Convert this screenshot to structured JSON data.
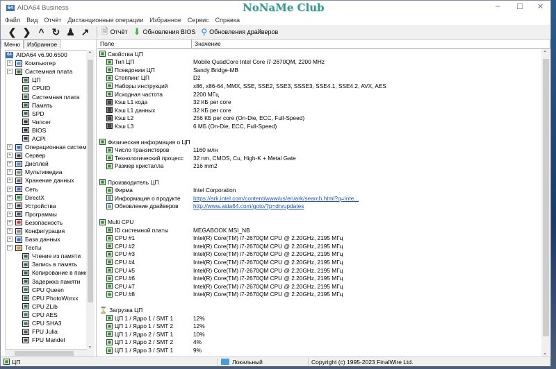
{
  "window": {
    "title": "AIDA64 Business",
    "brand": "NoNaMe Club"
  },
  "menu": [
    "Файл",
    "Вид",
    "Отчёт",
    "Дистанционные операции",
    "Избранное",
    "Сервис",
    "Справка"
  ],
  "toolbar": {
    "report": "Отчёт",
    "bios": "Обновления BIOS",
    "drivers": "Обновления драйверов"
  },
  "tabs": [
    "Меню",
    "Избранное"
  ],
  "tree": [
    {
      "label": "AIDA64 v6.90.6500",
      "lvl": 0,
      "icon": "aida64-icon",
      "color": "#3d6fb5"
    },
    {
      "label": "Компьютер",
      "lvl": 1,
      "pm": "+",
      "icon": "computer-icon",
      "color": "#4a9ad8"
    },
    {
      "label": "Системная плата",
      "lvl": 1,
      "pm": "-",
      "icon": "motherboard-icon",
      "color": "#3e7d3e"
    },
    {
      "label": "ЦП",
      "lvl": 2,
      "icon": "cpu-icon",
      "color": "#3e7d3e"
    },
    {
      "label": "CPUID",
      "lvl": 2,
      "icon": "cpu-icon",
      "color": "#3e7d3e"
    },
    {
      "label": "Системная плата",
      "lvl": 2,
      "icon": "motherboard-icon",
      "color": "#3e7d3e"
    },
    {
      "label": "Память",
      "lvl": 2,
      "icon": "memory-icon",
      "color": "#2f6f2f"
    },
    {
      "label": "SPD",
      "lvl": 2,
      "icon": "memory-icon",
      "color": "#2f6f2f"
    },
    {
      "label": "Чипсет",
      "lvl": 2,
      "icon": "chip-icon",
      "color": "#333"
    },
    {
      "label": "BIOS",
      "lvl": 2,
      "icon": "chip-icon",
      "color": "#333"
    },
    {
      "label": "ACPI",
      "lvl": 2,
      "icon": "chip-icon",
      "color": "#333"
    },
    {
      "label": "Операционная система",
      "lvl": 1,
      "pm": "+",
      "icon": "windows-icon",
      "color": "#1e6fd0"
    },
    {
      "label": "Сервер",
      "lvl": 1,
      "pm": "+",
      "icon": "server-icon",
      "color": "#444"
    },
    {
      "label": "Дисплей",
      "lvl": 1,
      "pm": "+",
      "icon": "display-icon",
      "color": "#4a9ad8"
    },
    {
      "label": "Мультимедиа",
      "lvl": 1,
      "pm": "+",
      "icon": "speaker-icon",
      "color": "#888"
    },
    {
      "label": "Хранение данных",
      "lvl": 1,
      "pm": "+",
      "icon": "storage-icon",
      "color": "#666"
    },
    {
      "label": "Сеть",
      "lvl": 1,
      "pm": "+",
      "icon": "network-icon",
      "color": "#3a7bd5"
    },
    {
      "label": "DirectX",
      "lvl": 1,
      "pm": "+",
      "icon": "xbox-icon",
      "color": "#22a030"
    },
    {
      "label": "Устройства",
      "lvl": 1,
      "pm": "+",
      "icon": "devices-icon",
      "color": "#444"
    },
    {
      "label": "Программы",
      "lvl": 1,
      "pm": "+",
      "icon": "programs-icon",
      "color": "#555"
    },
    {
      "label": "Безопасность",
      "lvl": 1,
      "pm": "+",
      "icon": "shield-icon",
      "color": "#d04020"
    },
    {
      "label": "Конфигурация",
      "lvl": 1,
      "pm": "+",
      "icon": "config-icon",
      "color": "#888"
    },
    {
      "label": "База данных",
      "lvl": 1,
      "pm": "+",
      "icon": "database-icon",
      "color": "#2a6ac0"
    },
    {
      "label": "Тесты",
      "lvl": 1,
      "pm": "-",
      "icon": "tests-icon",
      "color": "#e0a020"
    },
    {
      "label": "Чтение из памяти",
      "lvl": 2,
      "icon": "memory-icon",
      "color": "#2f6f2f"
    },
    {
      "label": "Запись в память",
      "lvl": 2,
      "icon": "memory-icon",
      "color": "#2f6f2f"
    },
    {
      "label": "Копирование в памяти",
      "lvl": 2,
      "icon": "memory-icon",
      "color": "#2f6f2f"
    },
    {
      "label": "Задержка памяти",
      "lvl": 2,
      "icon": "memory-icon",
      "color": "#2f6f2f"
    },
    {
      "label": "CPU Queen",
      "lvl": 2,
      "icon": "cpu-icon",
      "color": "#3e7d3e"
    },
    {
      "label": "CPU PhotoWorxx",
      "lvl": 2,
      "icon": "cpu-icon",
      "color": "#3e7d3e"
    },
    {
      "label": "CPU ZLib",
      "lvl": 2,
      "icon": "cpu-icon",
      "color": "#3e7d3e"
    },
    {
      "label": "CPU AES",
      "lvl": 2,
      "icon": "cpu-icon",
      "color": "#3e7d3e"
    },
    {
      "label": "CPU SHA3",
      "lvl": 2,
      "icon": "cpu-icon",
      "color": "#3e7d3e"
    },
    {
      "label": "FPU Julia",
      "lvl": 2,
      "icon": "fpu-icon",
      "color": "#555"
    },
    {
      "label": "FPU Mandel",
      "lvl": 2,
      "icon": "fpu-icon",
      "color": "#555"
    }
  ],
  "columns": {
    "field": "Поле",
    "value": "Значение"
  },
  "rows": [
    {
      "t": "g",
      "f": "Свойства ЦП"
    },
    {
      "t": "c",
      "f": "Тип ЦП",
      "v": "Mobile QuadCore Intel Core i7-2670QM, 2200 MHz"
    },
    {
      "t": "c",
      "f": "Псевдоним ЦП",
      "v": "Sandy Bridge-MB"
    },
    {
      "t": "c",
      "f": "Степпинг ЦП",
      "v": "D2"
    },
    {
      "t": "c",
      "f": "Наборы инструкций",
      "v": "x86, x86-64, MMX, SSE, SSE2, SSE3, SSSE3, SSE4.1, SSE4.2, AVX, AES"
    },
    {
      "t": "c",
      "f": "Исходная частота",
      "v": "2200 МГц"
    },
    {
      "t": "c",
      "i": "k",
      "f": "Кэш L1 кода",
      "v": "32 КБ per core"
    },
    {
      "t": "c",
      "i": "k",
      "f": "Кэш L1 данных",
      "v": "32 КБ per core"
    },
    {
      "t": "c",
      "i": "k",
      "f": "Кэш L2",
      "v": "256 КБ per core  (On-Die, ECC, Full-Speed)"
    },
    {
      "t": "c",
      "i": "k",
      "f": "Кэш L3",
      "v": "6 МБ  (On-Die, ECC, Full-Speed)"
    },
    {
      "t": "b"
    },
    {
      "t": "g",
      "f": "Физическая информация о ЦП"
    },
    {
      "t": "c",
      "f": "Число транзисторов",
      "v": "1160 млн"
    },
    {
      "t": "c",
      "f": "Технологический процесс",
      "v": "32 nm, CMOS, Cu, High-K + Metal Gate"
    },
    {
      "t": "c",
      "f": "Размер кристалла",
      "v": "216 mm2"
    },
    {
      "t": "b"
    },
    {
      "t": "g",
      "f": "Производитель ЦП"
    },
    {
      "t": "c",
      "f": "Фирма",
      "v": "Intel Corporation"
    },
    {
      "t": "c",
      "i": "l",
      "f": "Информация о продукте",
      "v": "https://ark.intel.com/content/www/us/en/ark/search.html?q=Inte...",
      "link": true
    },
    {
      "t": "c",
      "i": "l",
      "f": "Обновление драйверов",
      "v": "http://www.aida64.com/goto/?p=drvupdates",
      "link": true
    },
    {
      "t": "b"
    },
    {
      "t": "g",
      "f": "Multi CPU"
    },
    {
      "t": "c",
      "f": "ID системной платы",
      "v": "MEGABOOK MSI_NB"
    },
    {
      "t": "c",
      "f": "CPU #1",
      "v": "Intel(R) Core(TM) i7-2670QM CPU @ 2.20GHz, 2195 МГц"
    },
    {
      "t": "c",
      "f": "CPU #2",
      "v": "Intel(R) Core(TM) i7-2670QM CPU @ 2.20GHz, 2195 МГц"
    },
    {
      "t": "c",
      "f": "CPU #3",
      "v": "Intel(R) Core(TM) i7-2670QM CPU @ 2.20GHz, 2195 МГц"
    },
    {
      "t": "c",
      "f": "CPU #4",
      "v": "Intel(R) Core(TM) i7-2670QM CPU @ 2.20GHz, 2195 МГц"
    },
    {
      "t": "c",
      "f": "CPU #5",
      "v": "Intel(R) Core(TM) i7-2670QM CPU @ 2.20GHz, 2195 МГц"
    },
    {
      "t": "c",
      "f": "CPU #6",
      "v": "Intel(R) Core(TM) i7-2670QM CPU @ 2.20GHz, 2195 МГц"
    },
    {
      "t": "c",
      "f": "CPU #7",
      "v": "Intel(R) Core(TM) i7-2670QM CPU @ 2.20GHz, 2195 МГц"
    },
    {
      "t": "c",
      "f": "CPU #8",
      "v": "Intel(R) Core(TM) i7-2670QM CPU @ 2.20GHz, 2195 МГц"
    },
    {
      "t": "b"
    },
    {
      "t": "g",
      "i": "h",
      "f": "Загрузка ЦП"
    },
    {
      "t": "c",
      "f": "ЦП 1 / Ядро 1 / SMT 1",
      "v": "12%"
    },
    {
      "t": "c",
      "f": "ЦП 1 / Ядро 1 / SMT 2",
      "v": "12%"
    },
    {
      "t": "c",
      "f": "ЦП 1 / Ядро 2 / SMT 1",
      "v": "10%"
    },
    {
      "t": "c",
      "f": "ЦП 1 / Ядро 2 / SMT 2",
      "v": "4%"
    },
    {
      "t": "c",
      "f": "ЦП 1 / Ядро 3 / SMT 1",
      "v": "9%"
    }
  ],
  "status": {
    "left": "ЦП",
    "mid": "Локальный",
    "right": "Copyright (c) 1995-2023 FinalWire Ltd."
  }
}
